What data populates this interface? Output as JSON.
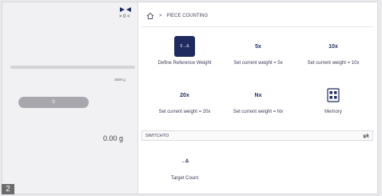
{
  "left_panel": {
    "zero_indicator": "> 0 <",
    "capacity_label": "3500 g",
    "pill_value": "0",
    "weight_value": "0.00 g"
  },
  "breadcrumb": {
    "home_icon": "home-icon",
    "separator": ">",
    "title": "PIECE COUNTING"
  },
  "tiles": [
    {
      "label": "Define Reference Weight",
      "icon_text": "0→Δ",
      "icon": "define-reference-icon"
    },
    {
      "label": "Set current weight = 5x",
      "icon_text": "5x",
      "icon": "x5-icon"
    },
    {
      "label": "Set current weight = 10x",
      "icon_text": "10x",
      "icon": "x10-icon"
    },
    {
      "label": "Set current weight = 20x",
      "icon_text": "20x",
      "icon": "x20-icon"
    },
    {
      "label": "Set current weight = Nx",
      "icon_text": "Nx",
      "icon": "nx-icon"
    },
    {
      "label": "Memory",
      "icon_text": "",
      "icon": "memory-icon"
    }
  ],
  "switch_to": {
    "label": "SWITCHTO",
    "icon": "swap-icon"
  },
  "target_tile": {
    "label": "Target Count",
    "icon_text": "→Δ",
    "icon": "target-count-icon"
  },
  "badge": "2",
  "colors": {
    "accent": "#1f2a5e",
    "left_bg": "#f1f1f3",
    "pill": "#a7a7ad"
  }
}
